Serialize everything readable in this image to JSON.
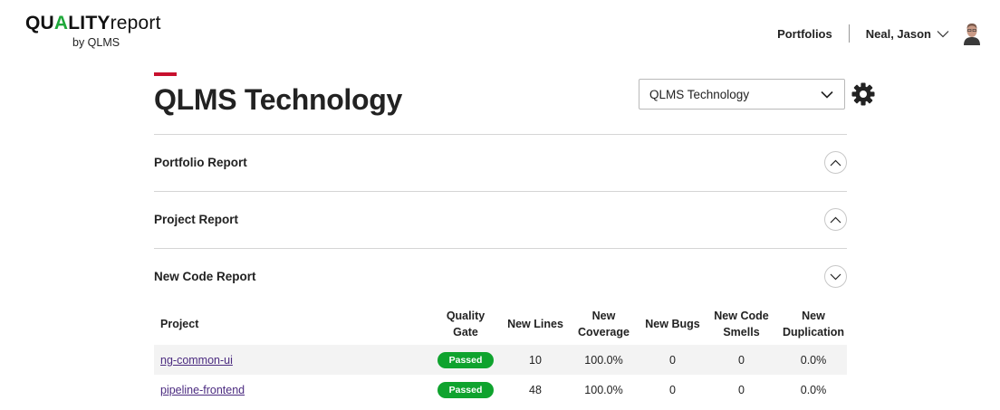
{
  "logo": {
    "quality_q": "QU",
    "quality_a": "A",
    "quality_rest": "LITY",
    "report": "report",
    "sub": "by QLMS"
  },
  "nav": {
    "portfolios": "Portfolios",
    "user_name": "Neal, Jason"
  },
  "page": {
    "title": "QLMS Technology"
  },
  "portfolio_select": {
    "value": "QLMS Technology"
  },
  "sections": [
    {
      "title": "Portfolio Report",
      "state": "collapsed"
    },
    {
      "title": "Project Report",
      "state": "collapsed"
    },
    {
      "title": "New Code Report",
      "state": "expanded"
    }
  ],
  "table": {
    "headers": {
      "project": "Project",
      "quality_gate_1": "Quality",
      "quality_gate_2": "Gate",
      "new_lines": "New Lines",
      "new_coverage_1": "New",
      "new_coverage_2": "Coverage",
      "new_bugs": "New Bugs",
      "new_code_smells_1": "New Code",
      "new_code_smells_2": "Smells",
      "new_duplication_1": "New",
      "new_duplication_2": "Duplication"
    },
    "rows": [
      {
        "project": "ng-common-ui",
        "gate": "Passed",
        "new_lines": "10",
        "new_coverage": "100.0%",
        "new_bugs": "0",
        "new_code_smells": "0",
        "new_duplication": "0.0%"
      },
      {
        "project": "pipeline-frontend",
        "gate": "Passed",
        "new_lines": "48",
        "new_coverage": "100.0%",
        "new_bugs": "0",
        "new_code_smells": "0",
        "new_duplication": "0.0%"
      }
    ]
  },
  "colors": {
    "accent": "#c8102e",
    "brand_green": "#1fa83a",
    "passed": "#0fa32e",
    "link": "#4b2b80"
  },
  "icons": {
    "user_menu": "chevron-down-icon",
    "select": "chevron-down-icon",
    "settings": "gear-icon",
    "collapsed_toggle": "chevron-up-icon",
    "expanded_toggle": "chevron-down-icon"
  }
}
